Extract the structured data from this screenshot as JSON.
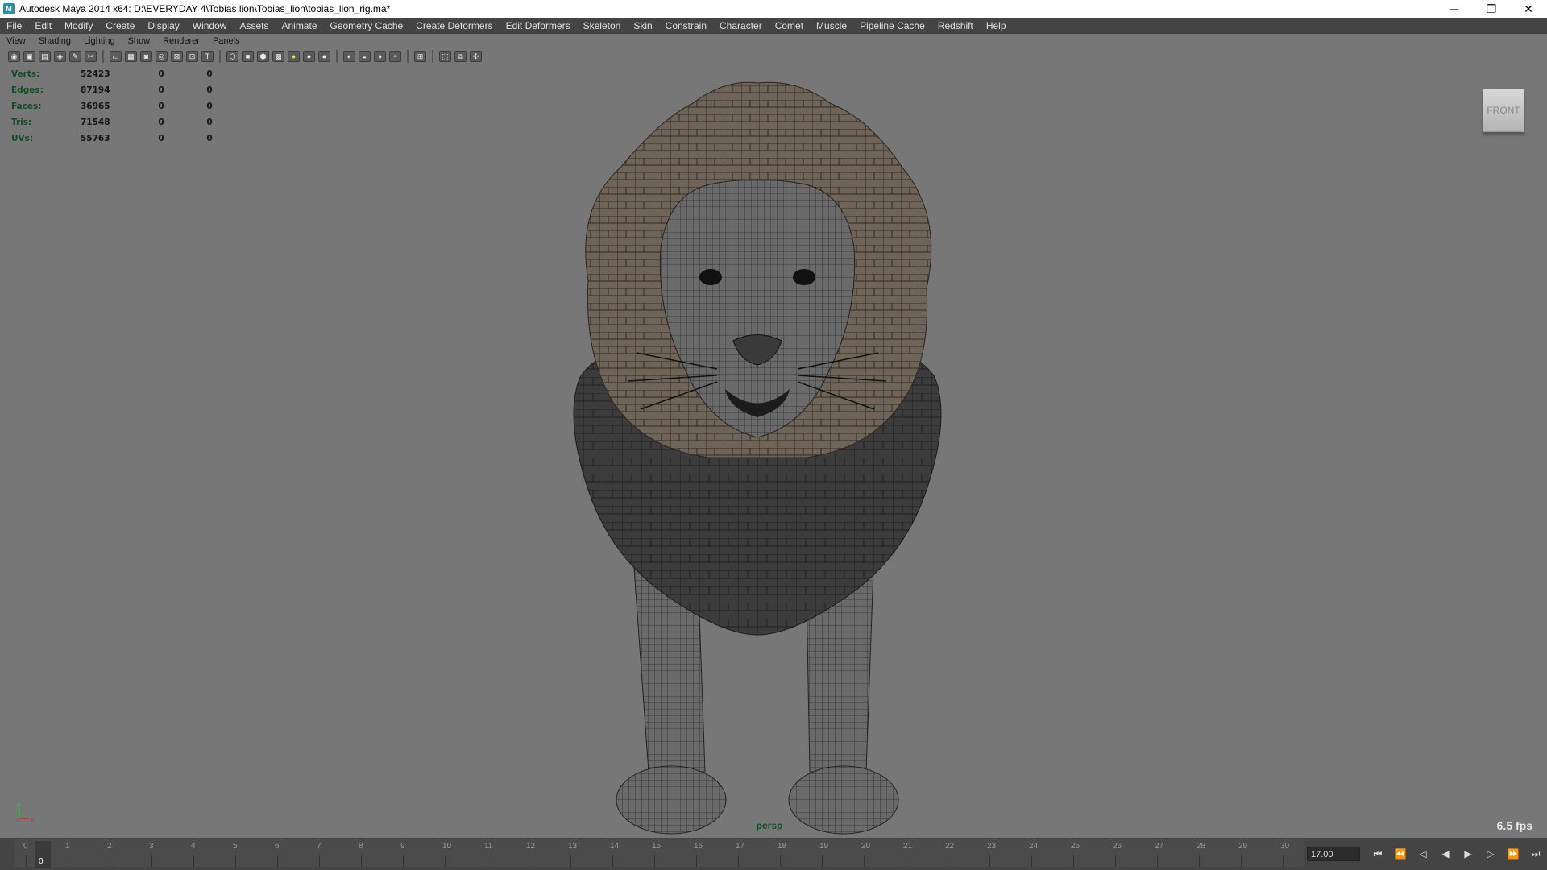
{
  "window": {
    "title": "Autodesk Maya 2014 x64: D:\\EVERYDAY 4\\Tobias lion\\Tobias_lion\\tobias_lion_rig.ma*",
    "icon": "maya-icon",
    "min_glyph": "─",
    "max_glyph": "❐",
    "close_glyph": "✕"
  },
  "menubar": [
    "File",
    "Edit",
    "Modify",
    "Create",
    "Display",
    "Window",
    "Assets",
    "Animate",
    "Geometry Cache",
    "Create Deformers",
    "Edit Deformers",
    "Skeleton",
    "Skin",
    "Constrain",
    "Character",
    "Comet",
    "Muscle",
    "Pipeline Cache",
    "Redshift",
    "Help"
  ],
  "panel_menu": [
    "View",
    "Shading",
    "Lighting",
    "Show",
    "Renderer",
    "Panels"
  ],
  "hud": {
    "rows": [
      {
        "label": "Verts:",
        "values": [
          "52423",
          "0",
          "0"
        ]
      },
      {
        "label": "Edges:",
        "values": [
          "87194",
          "0",
          "0"
        ]
      },
      {
        "label": "Faces:",
        "values": [
          "36965",
          "0",
          "0"
        ]
      },
      {
        "label": "Tris:",
        "values": [
          "71548",
          "0",
          "0"
        ]
      },
      {
        "label": "UVs:",
        "values": [
          "55763",
          "0",
          "0"
        ]
      }
    ]
  },
  "viewcube_label": "FRONT",
  "camera_name": "persp",
  "fps": "6.5 fps",
  "axis": {
    "y": "y",
    "z": "z",
    "x": "x"
  },
  "timeline": {
    "tick_labels": [
      "0",
      "1",
      "2",
      "3",
      "4",
      "5",
      "6",
      "7",
      "8",
      "9",
      "10",
      "11",
      "12",
      "13",
      "14",
      "15",
      "16",
      "17",
      "18",
      "19",
      "20",
      "21",
      "22",
      "23",
      "24",
      "25",
      "26",
      "27",
      "28",
      "29",
      "30"
    ],
    "current_frame": "0",
    "time_field": "17.00"
  },
  "colors": {
    "viewport_bg": "#777777",
    "ui_bg": "#444444",
    "hud_label": "#0d4f1f",
    "mane_light": "#6f6457",
    "mane_dark": "#3c3c3c"
  }
}
